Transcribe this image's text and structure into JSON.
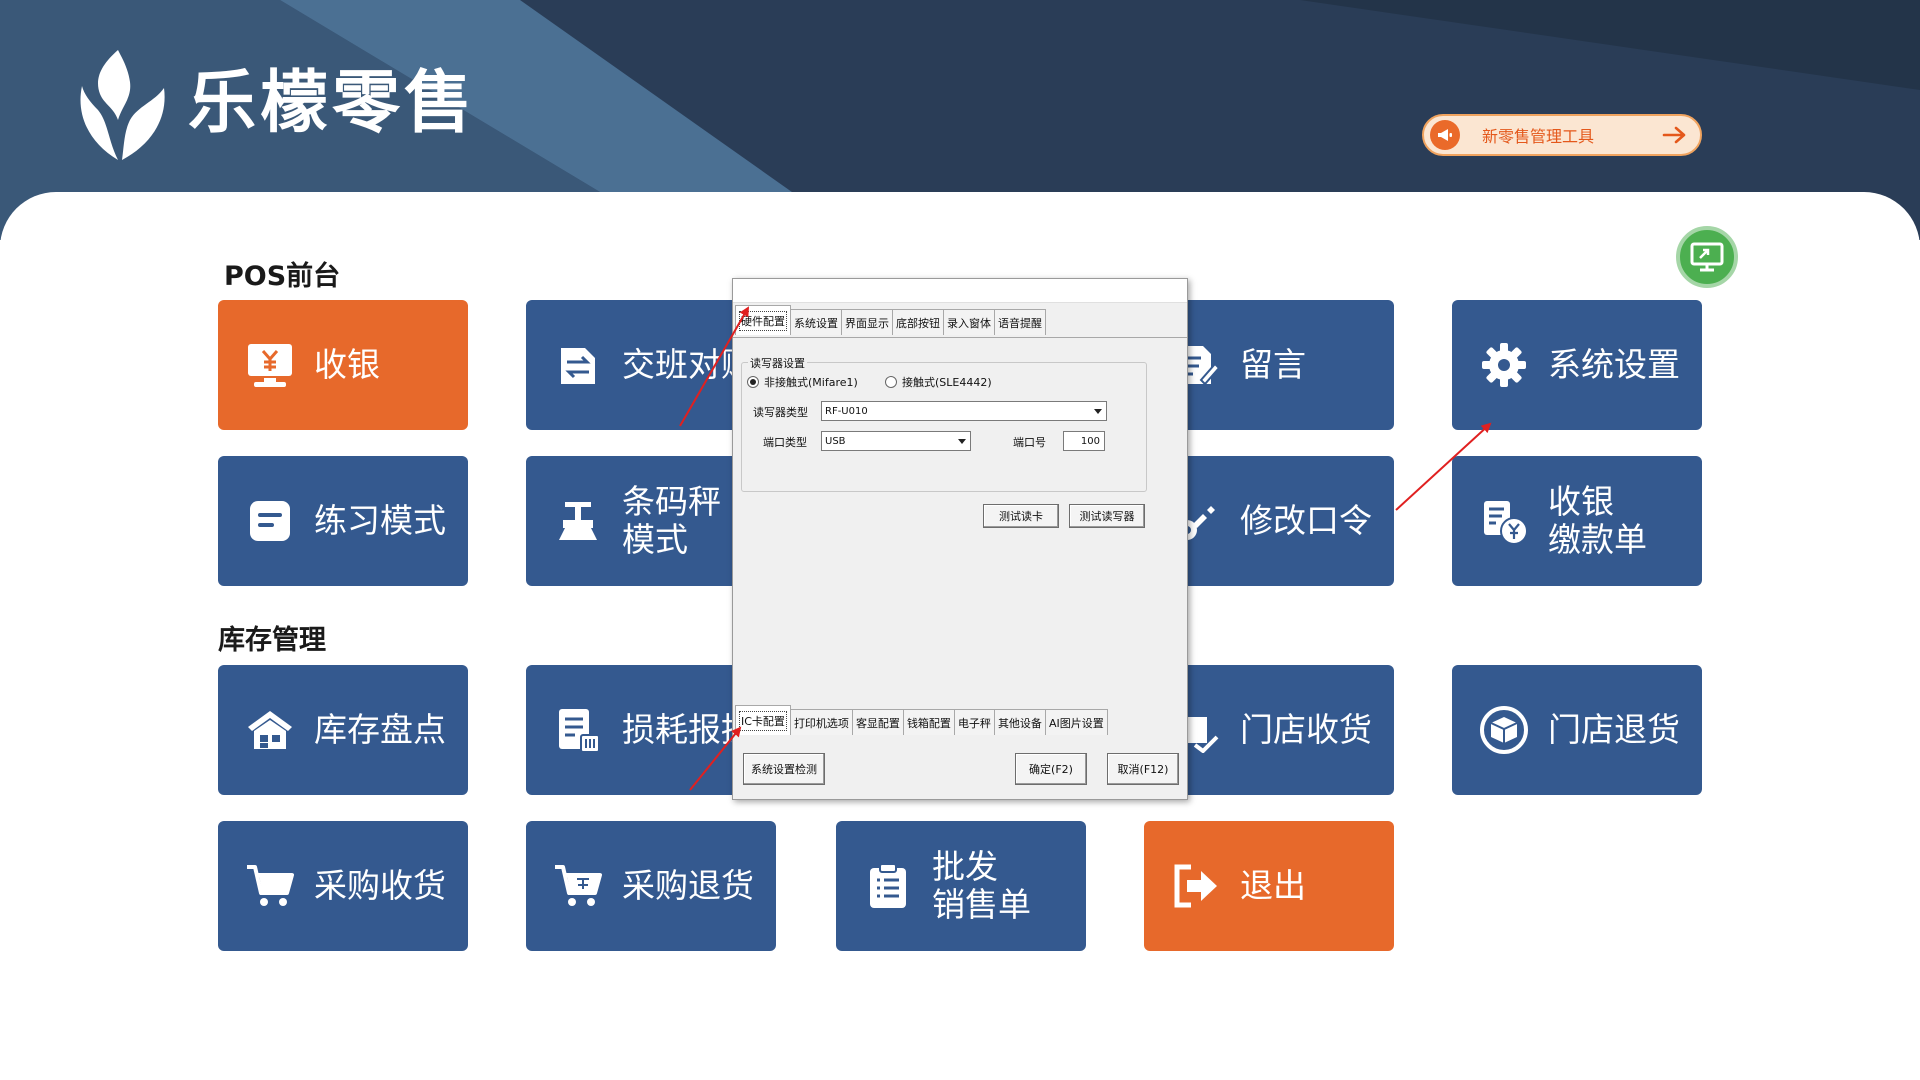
{
  "header": {
    "brand_title": "乐檬零售",
    "promo_label": "新零售管理工具"
  },
  "sections": {
    "pos": "POS前台",
    "inventory": "库存管理"
  },
  "tiles": {
    "cashier": "收银",
    "shift_handover": "交班对账",
    "message": "留言",
    "system_settings": "系统设置",
    "practice_mode": "练习模式",
    "barcode_scale": "条码秤\n模式",
    "change_password": "修改口令",
    "cashier_payment": "收银\n缴款单",
    "stocktake": "库存盘点",
    "loss_report": "损耗报损",
    "store_receiving": "门店收货",
    "store_return": "门店退货",
    "purchase_receiving": "采购收货",
    "purchase_return": "采购退货",
    "wholesale_order": "批发\n销售单",
    "exit": "退出"
  },
  "dialog": {
    "top_tabs": [
      "硬件配置",
      "系统设置",
      "界面显示",
      "底部按钮",
      "录入窗体",
      "语音提醒"
    ],
    "group_title": "读写器设置",
    "radio_contactless": "非接触式(Mifare1)",
    "radio_contact": "接触式(SLE4442)",
    "reader_type_label": "读写器类型",
    "reader_type_value": "RF-U010",
    "port_type_label": "端口类型",
    "port_type_value": "USB",
    "port_no_label": "端口号",
    "port_no_value": "100",
    "test_card_button": "测试读卡",
    "test_reader_button": "测试读写器",
    "bottom_tabs": [
      "IC卡配置",
      "打印机选项",
      "客显配置",
      "钱箱配置",
      "电子秤",
      "其他设备",
      "AI图片设置"
    ],
    "system_check_button": "系统设置检测",
    "ok_button": "确定(F2)",
    "cancel_button": "取消(F12)"
  },
  "colors": {
    "tile_blue": "#34598f",
    "tile_orange": "#e7692b",
    "header_dark": "#2a3d57",
    "annotation_red": "#e02020"
  }
}
